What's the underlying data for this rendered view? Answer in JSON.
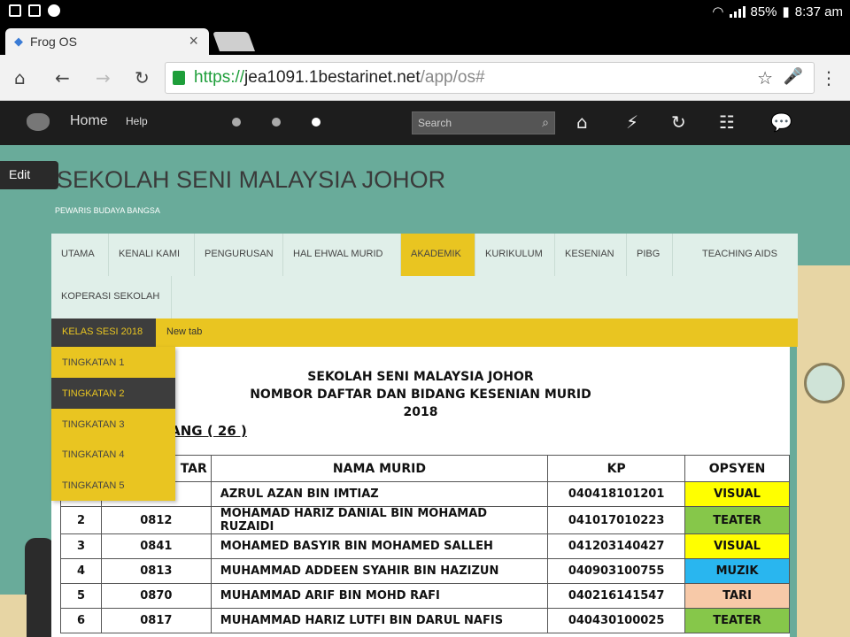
{
  "status_bar": {
    "battery": "85%",
    "time": "8:37 am"
  },
  "browser": {
    "tab_title": "Frog OS",
    "tab_close": "×",
    "url_scheme": "https://",
    "url_host": "jea1091.1bestarinet.net",
    "url_path": "/app/os#"
  },
  "frog_toolbar": {
    "home_label": "Home",
    "help_label": "Help",
    "search_placeholder": "Search"
  },
  "site": {
    "edit_label": "Edit",
    "title": "SEKOLAH SENI MALAYSIA JOHOR",
    "subtitle": "PEWARIS BUDAYA BANGSA"
  },
  "main_nav": [
    {
      "label": "UTAMA"
    },
    {
      "label": "KENALI KAMI"
    },
    {
      "label": "PENGURUSAN"
    },
    {
      "label": "HAL EHWAL MURID"
    },
    {
      "label": "AKADEMIK"
    },
    {
      "label": "KURIKULUM"
    },
    {
      "label": "KESENIAN"
    },
    {
      "label": "PIBG"
    },
    {
      "label": "TEACHING AIDS"
    },
    {
      "label": "KOPERASI SEKOLAH"
    }
  ],
  "sub_tabs": [
    {
      "label": "KELAS SESI 2018"
    },
    {
      "label": "New tab"
    }
  ],
  "dropdown": [
    {
      "label": "TINGKATAN 1"
    },
    {
      "label": "TINGKATAN 2"
    },
    {
      "label": "TINGKATAN 3"
    },
    {
      "label": "TINGKATAN 4"
    },
    {
      "label": "TINGKATAN 5"
    }
  ],
  "document": {
    "heading1": "SEKOLAH SENI MALAYSIA JOHOR",
    "heading2": "NOMBOR DAFTAR DAN BIDANG KESENIAN MURID",
    "heading3": "2018",
    "class_label": "INANG ( 26 )",
    "columns": [
      "TAR",
      "NAMA MURID",
      "KP",
      "OPSYEN"
    ],
    "rows": [
      {
        "no": "",
        "daftar": "",
        "nama": "AZRUL AZAN BIN IMTIAZ",
        "kp": "040418101201",
        "opsyen": "VISUAL"
      },
      {
        "no": "2",
        "daftar": "0812",
        "nama": "MOHAMAD HARIZ DANIAL BIN MOHAMAD RUZAIDI",
        "kp": "041017010223",
        "opsyen": "TEATER"
      },
      {
        "no": "3",
        "daftar": "0841",
        "nama": "MOHAMED BASYIR BIN MOHAMED SALLEH",
        "kp": "041203140427",
        "opsyen": "VISUAL"
      },
      {
        "no": "4",
        "daftar": "0813",
        "nama": "MUHAMMAD ADDEEN SYAHIR BIN HAZIZUN",
        "kp": "040903100755",
        "opsyen": "MUZIK"
      },
      {
        "no": "5",
        "daftar": "0870",
        "nama": "MUHAMMAD ARIF BIN MOHD RAFI",
        "kp": "040216141547",
        "opsyen": "TARI"
      },
      {
        "no": "6",
        "daftar": "0817",
        "nama": "MUHAMMAD HARIZ LUTFI BIN DARUL NAFIS",
        "kp": "040430100025",
        "opsyen": "TEATER"
      }
    ]
  },
  "option_colors": {
    "VISUAL": "#ffff00",
    "TEATER": "#86c74a",
    "MUZIK": "#29b6ef",
    "TARI": "#f7c9a8"
  }
}
